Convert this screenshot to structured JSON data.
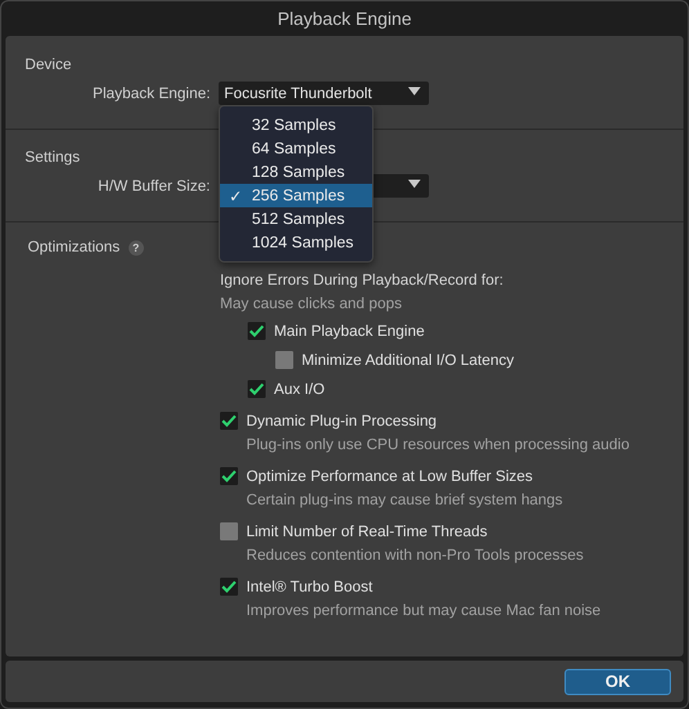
{
  "window": {
    "title": "Playback Engine"
  },
  "device": {
    "heading": "Device",
    "label": "Playback Engine:",
    "value": "Focusrite Thunderbolt"
  },
  "settings": {
    "heading": "Settings",
    "label": "H/W Buffer Size:",
    "menu_check": "✓",
    "menu": [
      {
        "label": "32 Samples",
        "selected": false
      },
      {
        "label": "64 Samples",
        "selected": false
      },
      {
        "label": "128 Samples",
        "selected": false
      },
      {
        "label": "256 Samples",
        "selected": true
      },
      {
        "label": "512 Samples",
        "selected": false
      },
      {
        "label": "1024 Samples",
        "selected": false
      }
    ]
  },
  "optimizations": {
    "heading": "Optimizations",
    "help": "?",
    "ignore_errors": {
      "title": "Ignore Errors During Playback/Record for:",
      "note": "May cause clicks and pops",
      "options": [
        {
          "label": "Main Playback Engine",
          "checked": true,
          "children": [
            {
              "label": "Minimize Additional I/O Latency",
              "checked": false
            }
          ]
        },
        {
          "label": "Aux I/O",
          "checked": true
        }
      ]
    },
    "options": [
      {
        "label": "Dynamic Plug-in Processing",
        "checked": true,
        "description": "Plug-ins only use CPU resources when processing audio"
      },
      {
        "label": "Optimize Performance at Low Buffer Sizes",
        "checked": true,
        "description": "Certain plug-ins may cause brief system hangs"
      },
      {
        "label": "Limit Number of Real-Time Threads",
        "checked": false,
        "description": "Reduces contention with non-Pro Tools processes"
      },
      {
        "label": "Intel® Turbo Boost",
        "checked": true,
        "description": "Improves performance but may cause Mac fan noise"
      }
    ]
  },
  "buttons": [
    {
      "label": "OK"
    }
  ]
}
